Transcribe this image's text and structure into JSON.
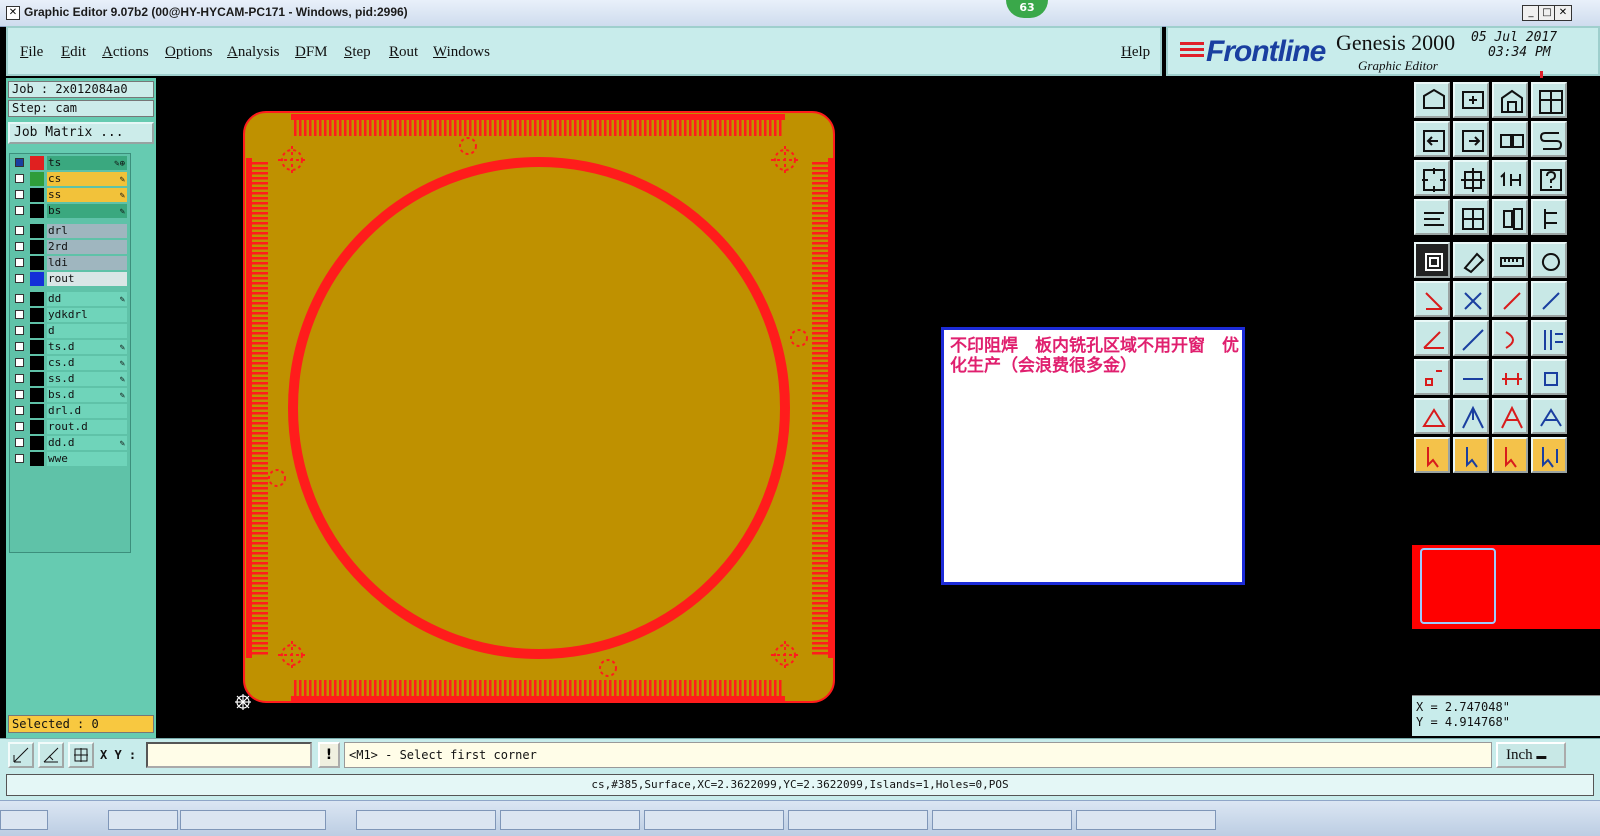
{
  "window": {
    "title": "Graphic Editor 9.07b2 (00@HY-HYCAM-PC171 - Windows, pid:2996)",
    "badge": "63"
  },
  "menu": {
    "items": [
      "File",
      "Edit",
      "Actions",
      "Options",
      "Analysis",
      "DFM",
      "Step",
      "Rout",
      "Windows"
    ],
    "help": "Help"
  },
  "brand": {
    "logo": "Frontline",
    "product": "Genesis 2000",
    "subtitle": "Graphic Editor",
    "date": "05 Jul 2017",
    "time": "03:34 PM"
  },
  "job": {
    "job_label": "Job : 2x012084a0",
    "step_label": "Step: cam",
    "matrix_button": "Job Matrix ..."
  },
  "layers": [
    {
      "name": "ts",
      "color": "#e02020",
      "bg": "#3aa87f",
      "mark": "✎⊕",
      "active": true
    },
    {
      "name": "cs",
      "color": "#2f9d3a",
      "bg": "#f2c23a",
      "mark": "✎"
    },
    {
      "name": "ss",
      "color": "#000000",
      "bg": "#f2c23a",
      "mark": "✎"
    },
    {
      "name": "bs",
      "color": "#000000",
      "bg": "#3aa87f",
      "mark": "✎"
    },
    {
      "name": "drl",
      "color": "#000000",
      "bg": "#9fb6bf",
      "mark": ""
    },
    {
      "name": "2rd",
      "color": "#000000",
      "bg": "#9fb6bf",
      "mark": ""
    },
    {
      "name": "ldi",
      "color": "#000000",
      "bg": "#9fb6bf",
      "mark": ""
    },
    {
      "name": "rout",
      "color": "#1430d8",
      "bg": "#d9e6e6",
      "mark": ""
    },
    {
      "name": "dd",
      "color": "#000000",
      "bg": "#6fd4ba",
      "mark": "✎"
    },
    {
      "name": "ydkdrl",
      "color": "#000000",
      "bg": "#6fd4ba",
      "mark": ""
    },
    {
      "name": "d",
      "color": "#000000",
      "bg": "#6fd4ba",
      "mark": ""
    },
    {
      "name": "ts.d",
      "color": "#000000",
      "bg": "#6fd4ba",
      "mark": "✎"
    },
    {
      "name": "cs.d",
      "color": "#000000",
      "bg": "#6fd4ba",
      "mark": "✎"
    },
    {
      "name": "ss.d",
      "color": "#000000",
      "bg": "#6fd4ba",
      "mark": "✎"
    },
    {
      "name": "bs.d",
      "color": "#000000",
      "bg": "#6fd4ba",
      "mark": "✎"
    },
    {
      "name": "drl.d",
      "color": "#000000",
      "bg": "#6fd4ba",
      "mark": ""
    },
    {
      "name": "rout.d",
      "color": "#000000",
      "bg": "#6fd4ba",
      "mark": ""
    },
    {
      "name": "dd.d",
      "color": "#000000",
      "bg": "#6fd4ba",
      "mark": "✎"
    },
    {
      "name": "wwe",
      "color": "#000000",
      "bg": "#6fd4ba",
      "mark": ""
    }
  ],
  "selected": "Selected : 0",
  "note": {
    "text": "不印阻焊　板内铣孔区域不用开窗　优化生产（会浪费很多金）"
  },
  "coords": {
    "x": "X = 2.747048\"",
    "y": "Y = 4.914768\""
  },
  "bottom": {
    "xy_label": "X Y :",
    "input_value": "",
    "warn": "!",
    "prompt": "<M1> - Select first corner",
    "unit": "Inch"
  },
  "status": "cs,#385,Surface,XC=2.3622099,YC=2.3622099,Islands=1,Holes=0,POS",
  "colors": {
    "board": "#bf9100",
    "copper": "#ff1c1c",
    "panel": "#c8eceb",
    "left_panel": "#66cbb1"
  }
}
